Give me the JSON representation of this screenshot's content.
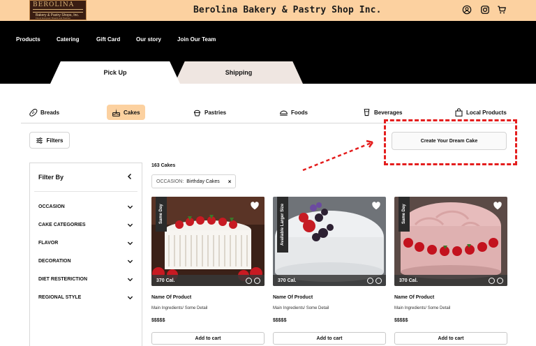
{
  "header": {
    "logo_text": "BEROLINA",
    "logo_subtitle": "Bakery & Pastry Shops, Inc.",
    "logo_tagline": "Finest European Breads and Pastries",
    "title": "Berolina Bakery & Pastry Shop Inc.",
    "icons": [
      "user-icon",
      "instagram-icon",
      "cart-icon"
    ]
  },
  "nav": {
    "items": [
      "Products",
      "Catering",
      "Gift Card",
      "Our story",
      "Join Our Team"
    ]
  },
  "tabs": [
    {
      "label": "Pick Up",
      "active": true
    },
    {
      "label": "Shipping",
      "active": false
    }
  ],
  "categories": [
    {
      "label": "Breads",
      "icon": "bread-icon",
      "active": false
    },
    {
      "label": "Cakes",
      "icon": "cake-icon",
      "active": true
    },
    {
      "label": "Pastries",
      "icon": "cupcake-icon",
      "active": false
    },
    {
      "label": "Foods",
      "icon": "food-icon",
      "active": false
    },
    {
      "label": "Beverages",
      "icon": "beverage-icon",
      "active": false
    },
    {
      "label": "Local Products",
      "icon": "bag-icon",
      "active": false
    }
  ],
  "toolbar": {
    "filters_label": "Filters",
    "dream_cake_label": "Create Your Dream Cake"
  },
  "sidebar": {
    "title": "Filter By",
    "sections": [
      "OCCASION",
      "CAKE CATEGORIES",
      "FLAVOR",
      "DECORATION",
      "DIET RESTERICTION",
      "REGIONAL STYLE"
    ]
  },
  "results": {
    "count": "163 Cakes",
    "chip_key": "OCCASION:",
    "chip_value": "Birthday Cakes",
    "chip_close": "×"
  },
  "products": [
    {
      "ribbon": "Same Day",
      "calories": "370 Cal.",
      "name": "Name Of Product",
      "detail": "Main Ingredients/ Some Detail",
      "price": "$$$$$",
      "cart_label": "Add to cart"
    },
    {
      "ribbon": "Available Larger Size",
      "calories": "370 Cal.",
      "name": "Name Of Product",
      "detail": "Main Ingredients/ Some Detail",
      "price": "$$$$$",
      "cart_label": "Add to cart"
    },
    {
      "ribbon": "Same Day",
      "calories": "370 Cal.",
      "name": "Name Of Product",
      "detail": "Main Ingredients/ Some Detail",
      "price": "$$$$$",
      "cart_label": "Add to cart"
    }
  ],
  "colors": {
    "header_bg": "#fcd1a0",
    "nav_bg": "#000000",
    "active_category_bg": "#fcd1a0",
    "annotation_red": "#e41e1e"
  }
}
